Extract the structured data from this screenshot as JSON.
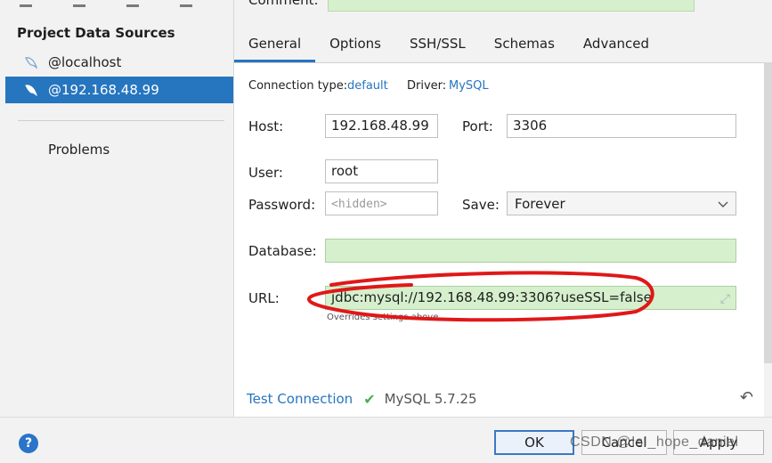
{
  "sidebar": {
    "heading": "Project Data Sources",
    "items": [
      {
        "label": "@localhost"
      },
      {
        "label": "@192.168.48.99"
      }
    ],
    "problems": "Problems"
  },
  "comment_label": "Comment:",
  "tabs": [
    {
      "label": "General"
    },
    {
      "label": "Options"
    },
    {
      "label": "SSH/SSL"
    },
    {
      "label": "Schemas"
    },
    {
      "label": "Advanced"
    }
  ],
  "form": {
    "conn_type_label": "Connection type:",
    "conn_type_value": "default",
    "driver_label": "Driver:",
    "driver_value": "MySQL",
    "host_label": "Host:",
    "host_value": "192.168.48.99",
    "port_label": "Port:",
    "port_value": "3306",
    "user_label": "User:",
    "user_value": "root",
    "password_label": "Password:",
    "password_placeholder": "<hidden>",
    "save_label": "Save:",
    "save_value": "Forever",
    "database_label": "Database:",
    "database_value": "",
    "url_label": "URL:",
    "url_value": "jdbc:mysql://192.168.48.99:3306?useSSL=false",
    "url_hint": "Overrides settings above"
  },
  "test": {
    "label": "Test Connection",
    "status": "MySQL 5.7.25"
  },
  "buttons": {
    "help": "?",
    "ok": "OK",
    "cancel": "Cancel",
    "apply": "Apply"
  },
  "watermark": "CSDN @IsI_hope_daniel",
  "colors": {
    "accent": "#2675bf",
    "selection": "#2675bf",
    "field_green": "#d6f0cd",
    "annotation_red": "#e01818",
    "success_check": "#4caf50"
  }
}
